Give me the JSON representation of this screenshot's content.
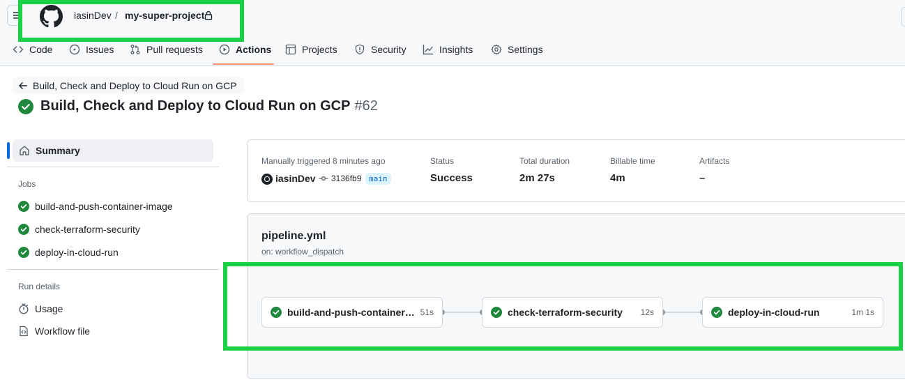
{
  "repo": {
    "owner": "iasinDev",
    "separator": "/",
    "name": "my-super-project"
  },
  "nav": [
    {
      "label": "Code",
      "icon": "code-icon"
    },
    {
      "label": "Issues",
      "icon": "issue-opened-icon"
    },
    {
      "label": "Pull requests",
      "icon": "git-pull-request-icon"
    },
    {
      "label": "Actions",
      "icon": "play-icon",
      "active": true
    },
    {
      "label": "Projects",
      "icon": "table-icon"
    },
    {
      "label": "Security",
      "icon": "shield-icon"
    },
    {
      "label": "Insights",
      "icon": "graph-icon"
    },
    {
      "label": "Settings",
      "icon": "gear-icon"
    }
  ],
  "breadcrumb": {
    "label": "Build, Check and Deploy to Cloud Run on GCP"
  },
  "run": {
    "title": "Build, Check and Deploy to Cloud Run on GCP",
    "number": "#62"
  },
  "sidebar": {
    "summary_label": "Summary",
    "jobs_heading": "Jobs",
    "jobs": [
      {
        "name": "build-and-push-container-image",
        "status": "success"
      },
      {
        "name": "check-terraform-security",
        "status": "success"
      },
      {
        "name": "deploy-in-cloud-run",
        "status": "success"
      }
    ],
    "run_details_heading": "Run details",
    "usage_label": "Usage",
    "workflow_file_label": "Workflow file"
  },
  "summary": {
    "trigger_label": "Manually triggered 8 minutes ago",
    "actor": "iasinDev",
    "commit": "3136fb9",
    "branch": "main",
    "status_label": "Status",
    "status_value": "Success",
    "duration_label": "Total duration",
    "duration_value": "2m 27s",
    "billable_label": "Billable time",
    "billable_value": "4m",
    "artifacts_label": "Artifacts",
    "artifacts_value": "–"
  },
  "workflow": {
    "file": "pipeline.yml",
    "trigger": "on: workflow_dispatch",
    "jobs": [
      {
        "name": "build-and-push-container-image",
        "duration": "51s",
        "status": "success"
      },
      {
        "name": "check-terraform-security",
        "duration": "12s",
        "status": "success"
      },
      {
        "name": "deploy-in-cloud-run",
        "duration": "1m 1s",
        "status": "success"
      }
    ]
  },
  "colors": {
    "success": "#1f883d",
    "highlight": "#1dd147",
    "active_tab_underline": "#fd8c73",
    "accent": "#0969da"
  }
}
